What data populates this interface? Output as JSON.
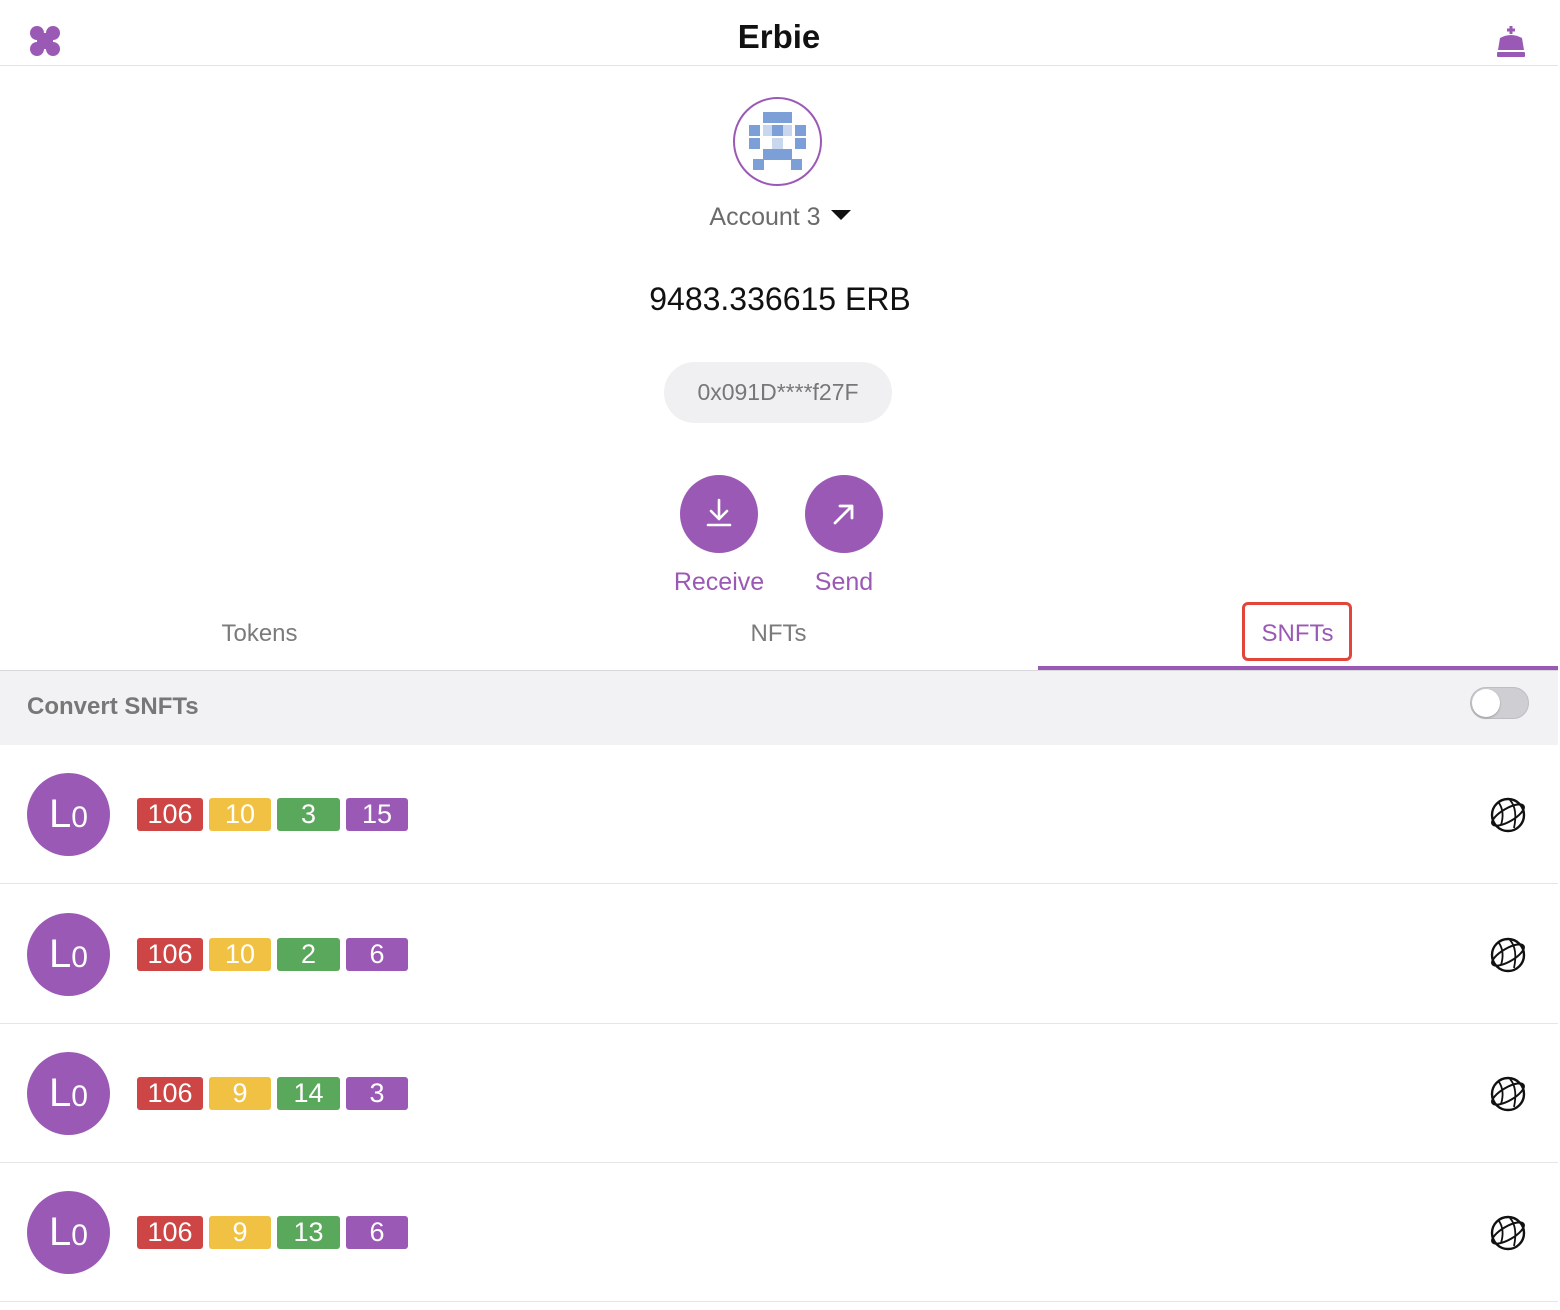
{
  "header": {
    "title": "Erbie",
    "menu_icon": "grid-menu-icon",
    "crown_icon": "crown-icon"
  },
  "account": {
    "name": "Account 3",
    "balance": "9483.336615 ERB",
    "address": "0x091D****f27F"
  },
  "actions": {
    "receive_label": "Receive",
    "send_label": "Send"
  },
  "tabs": [
    {
      "label": "Tokens",
      "active": false
    },
    {
      "label": "NFTs",
      "active": false
    },
    {
      "label": "SNFTs",
      "active": true
    }
  ],
  "convert": {
    "label": "Convert SNFTs",
    "enabled": false
  },
  "snfts": [
    {
      "avatar_main": "L",
      "avatar_sub": "0",
      "badges": [
        "106",
        "10",
        "3",
        "15"
      ]
    },
    {
      "avatar_main": "L",
      "avatar_sub": "0",
      "badges": [
        "106",
        "10",
        "2",
        "6"
      ]
    },
    {
      "avatar_main": "L",
      "avatar_sub": "0",
      "badges": [
        "106",
        "9",
        "14",
        "3"
      ]
    },
    {
      "avatar_main": "L",
      "avatar_sub": "0",
      "badges": [
        "106",
        "9",
        "13",
        "6"
      ]
    }
  ],
  "colors": {
    "accent": "#9b59b6",
    "badge_red": "#cd4545",
    "badge_yellow": "#f0c143",
    "badge_green": "#5aa85b",
    "badge_purple": "#9b59b6",
    "highlight": "#e2453a"
  }
}
